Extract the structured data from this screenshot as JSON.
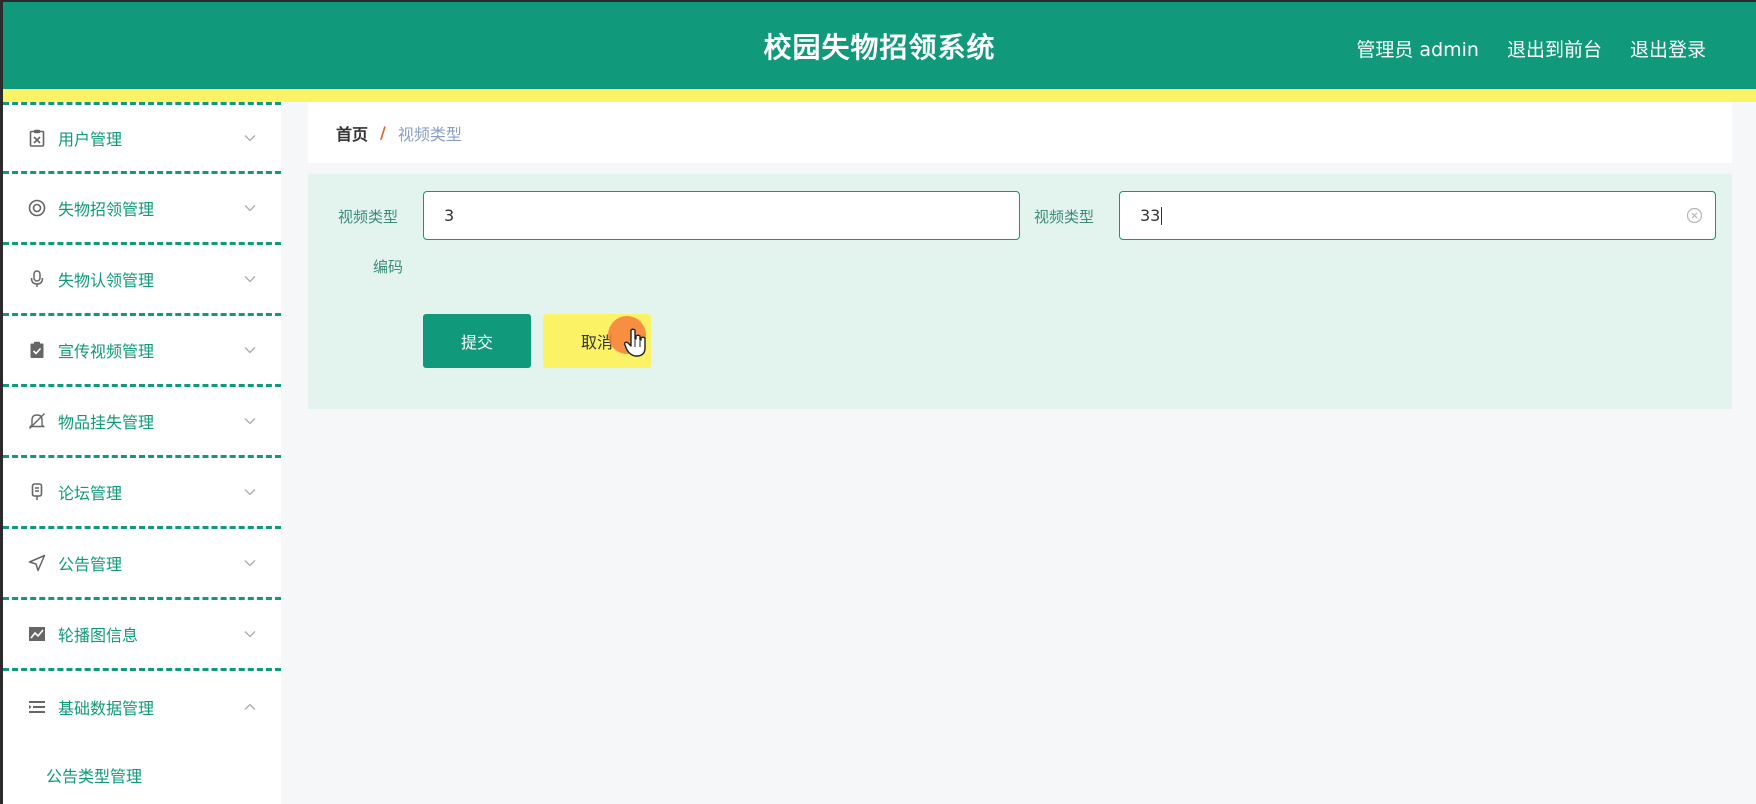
{
  "header": {
    "title": "校园失物招领系统",
    "user_label": "管理员 admin",
    "to_frontend": "退出到前台",
    "logout": "退出登录"
  },
  "sidebar": {
    "items": [
      {
        "label": "用户管理",
        "icon": "clipboard-x-icon"
      },
      {
        "label": "失物招领管理",
        "icon": "lifebuoy-icon"
      },
      {
        "label": "失物认领管理",
        "icon": "microphone-icon"
      },
      {
        "label": "宣传视频管理",
        "icon": "clipboard-check-icon"
      },
      {
        "label": "物品挂失管理",
        "icon": "bell-off-icon"
      },
      {
        "label": "论坛管理",
        "icon": "mic-stand-icon"
      },
      {
        "label": "公告管理",
        "icon": "send-icon"
      },
      {
        "label": "轮播图信息",
        "icon": "chart-icon"
      },
      {
        "label": "基础数据管理",
        "icon": "list-icon"
      }
    ],
    "sub_items": [
      {
        "label": "公告类型管理"
      }
    ]
  },
  "breadcrumb": {
    "home": "首页",
    "separator": "/",
    "current": "视频类型"
  },
  "form": {
    "field1_label": "视频类型编码",
    "field1_label_line1": "视频类型",
    "field1_label_line2": "编码",
    "field1_value": "3",
    "field2_label": "视频类型",
    "field2_value": "33",
    "submit_label": "提交",
    "cancel_label": "取消"
  },
  "colors": {
    "primary": "#10997b",
    "accent_yellow": "#fcf266",
    "panel_bg": "#e3f3ee",
    "breadcrumb_sep": "#e0632f"
  }
}
